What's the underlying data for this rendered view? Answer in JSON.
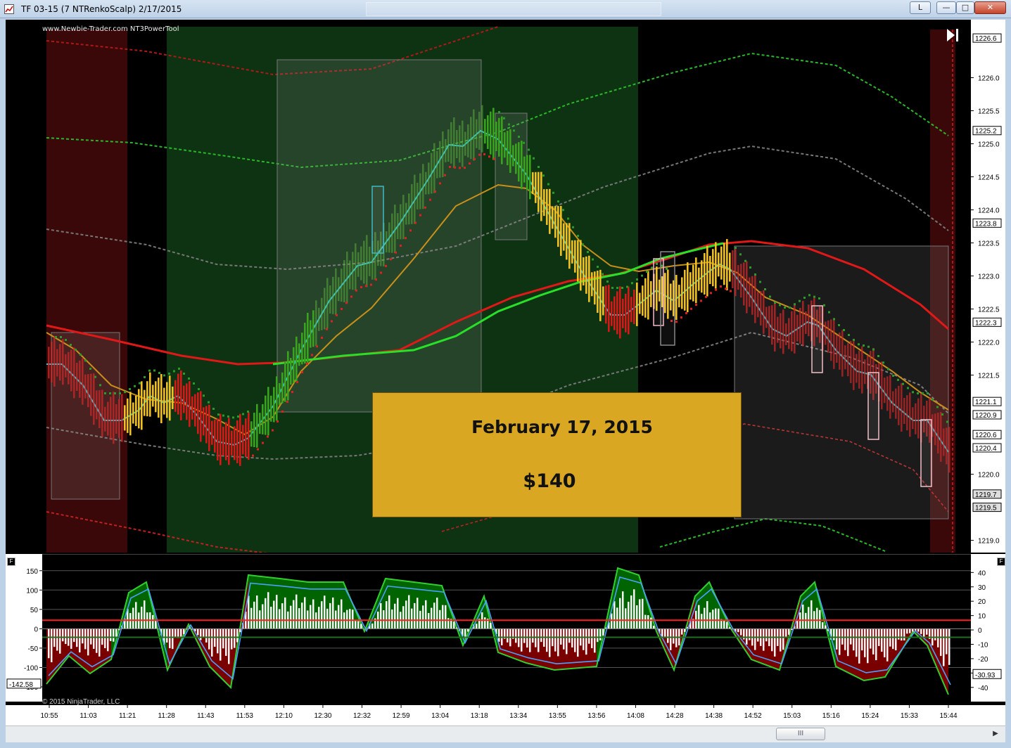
{
  "window": {
    "title": "TF 03-15 (7 NTRenkoScalp)  2/17/2015",
    "buttons": {
      "layout": "L",
      "minimize": "—",
      "maximize": "□",
      "close": "✕"
    }
  },
  "watermark": "www.Newbie-Trader.com NT3PowerTool",
  "copyright": "© 2015 NinjaTrader, LLC",
  "panel_flag": "F",
  "callout": {
    "date": "February 17, 2015",
    "amount": "$140"
  },
  "price_axis": {
    "ticks": [
      "1226.0",
      "1225.5",
      "1225.0",
      "1224.5",
      "1224.0",
      "1223.5",
      "1223.0",
      "1222.5",
      "1222.0",
      "1221.5",
      "1220.0",
      "1219.0"
    ],
    "markers": [
      "1226.6",
      "1225.2",
      "1223.8",
      "1222.3",
      "1221.1",
      "1220.9",
      "1220.6",
      "1220.4",
      "1219.7",
      "1219.5"
    ],
    "markers_boxed": [
      "1219.7",
      "1219.5"
    ]
  },
  "osc_axis": {
    "left_ticks": [
      "150",
      "100",
      "50",
      "0",
      "-50",
      "-100",
      "-150"
    ],
    "right_ticks": [
      "40",
      "30",
      "20",
      "10",
      "0",
      "-10",
      "-20",
      "-30",
      "-40"
    ],
    "left_marker": "-142.58",
    "right_marker": "-30.93"
  },
  "time_axis": [
    "10:55",
    "11:03",
    "11:21",
    "11:28",
    "11:43",
    "11:53",
    "12:10",
    "12:30",
    "12:32",
    "12:59",
    "13:04",
    "13:18",
    "13:34",
    "13:55",
    "13:56",
    "14:08",
    "14:28",
    "14:38",
    "14:52",
    "15:03",
    "15:16",
    "15:24",
    "15:33",
    "15:44"
  ],
  "scrollbar": {
    "thumb_label": "III",
    "right_arrow": "▶"
  },
  "colors": {
    "bull": "#3aa31d",
    "bear": "#c81818",
    "neutral": "#f0c020",
    "ma_slow": "#e01818",
    "ma_fast_up": "#28e028",
    "band_upper": "#28b828",
    "band_lower": "#c82020",
    "callout": "#d9a722",
    "cyan_line": "#38c8d8"
  },
  "chart_data": [
    {
      "type": "line",
      "y_range": [
        1218.9,
        1226.75
      ],
      "series": [
        {
          "values": [
            1222.3,
            1222.2,
            1222.0,
            1221.8,
            1221.7,
            1221.9,
            1222.4,
            1222.8,
            1223.2,
            1223.2,
            1223.0,
            1222.8,
            1222.8,
            1223.2,
            1223.6,
            1223.8,
            1223.7,
            1223.4,
            1223.2,
            1222.9,
            1222.3
          ]
        }
      ]
    },
    {
      "type": "bar",
      "y_range_left": [
        -170,
        175
      ],
      "y_range_right": [
        -45,
        48
      ]
    }
  ]
}
